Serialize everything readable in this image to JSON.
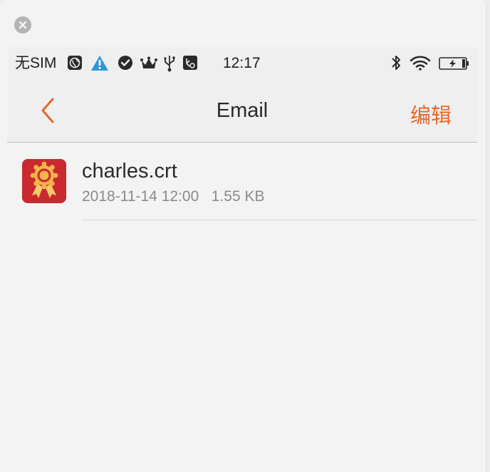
{
  "window": {
    "close_icon": "close-icon"
  },
  "status_bar": {
    "carrier": "无SIM",
    "time": "12:17",
    "icons": [
      "globe-icon",
      "warning-icon",
      "check-circle-icon",
      "crown-icon",
      "usb-icon",
      "sd-card-icon",
      "bluetooth-icon",
      "wifi-icon",
      "battery-charging-icon"
    ]
  },
  "nav": {
    "back_icon": "chevron-left-icon",
    "title": "Email",
    "edit_label": "编辑"
  },
  "files": [
    {
      "name": "charles.crt",
      "meta": "2018-11-14 12:00   1.55 KB",
      "icon": "certificate-icon"
    }
  ],
  "colors": {
    "accent": "#e5682e",
    "certificate_bg": "#c9292f",
    "certificate_fg": "#f2b54a"
  }
}
